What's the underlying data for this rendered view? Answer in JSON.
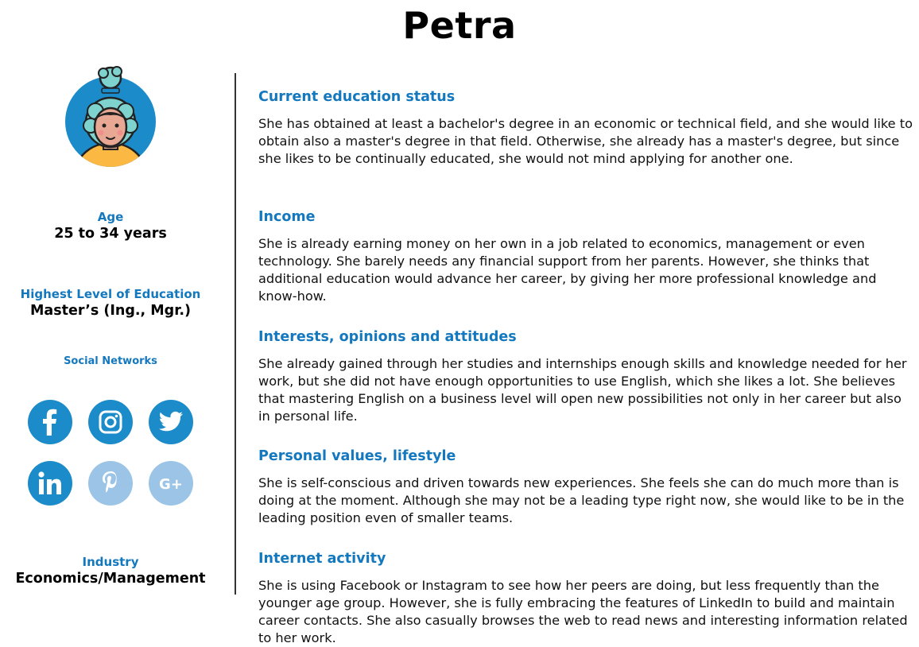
{
  "persona": {
    "name": "Petra"
  },
  "profile": {
    "age_label": "Age",
    "age_value": "25 to 34 years",
    "education_label": "Highest Level of Education",
    "education_value": "Master’s (Ing., Mgr.)",
    "social_label": "Social Networks",
    "industry_label": "Industry",
    "industry_value": "Economics/Management"
  },
  "social_networks": [
    {
      "icon": "facebook-icon",
      "color": "#1b8bc9"
    },
    {
      "icon": "instagram-icon",
      "color": "#1b8bc9"
    },
    {
      "icon": "twitter-icon",
      "color": "#1b8bc9"
    },
    {
      "icon": "linkedin-icon",
      "color": "#1b8bc9"
    },
    {
      "icon": "pinterest-icon",
      "color": "#9bc4e6"
    },
    {
      "icon": "google-plus-icon",
      "color": "#9bc4e6"
    }
  ],
  "sections": [
    {
      "title": "Current education status",
      "body": "She has obtained at least a bachelor's degree in an economic or technical field, and she would like to obtain also a master's degree in that field. Otherwise, she already has a master's degree, but since she likes to be continually educated, she would not mind applying for another one."
    },
    {
      "title": "Income",
      "body": "She is already earning money on her own in a job related to economics, management or even technology. She barely needs any financial support from her parents. However, she thinks that additional education would advance her career, by giving her more professional knowledge and know-how."
    },
    {
      "title": "Interests, opinions and attitudes",
      "body": "She already gained through her studies and internships enough skills and knowledge needed for her work, but she did not have enough opportunities to use English, which she likes a lot. She believes that mastering English on a business level will open new possibilities not only in her career but also in personal life."
    },
    {
      "title": "Personal values, lifestyle",
      "body": "She is self-conscious and driven towards new experiences. She feels she can do much more than is doing at the moment. Although she may not be a leading type right now, she would like to be in the leading position even of smaller teams."
    },
    {
      "title": "Internet activity",
      "body": "She is using Facebook or Instagram to see how her peers are doing, but less frequently than the younger age group. However, she is fully embracing the features of LinkedIn to build and maintain career contacts. She also casually browses the web to read news and interesting information related to her work."
    }
  ],
  "colors": {
    "accent": "#1478be",
    "icon_active": "#1b8bc9",
    "icon_faded": "#9bc4e6"
  }
}
